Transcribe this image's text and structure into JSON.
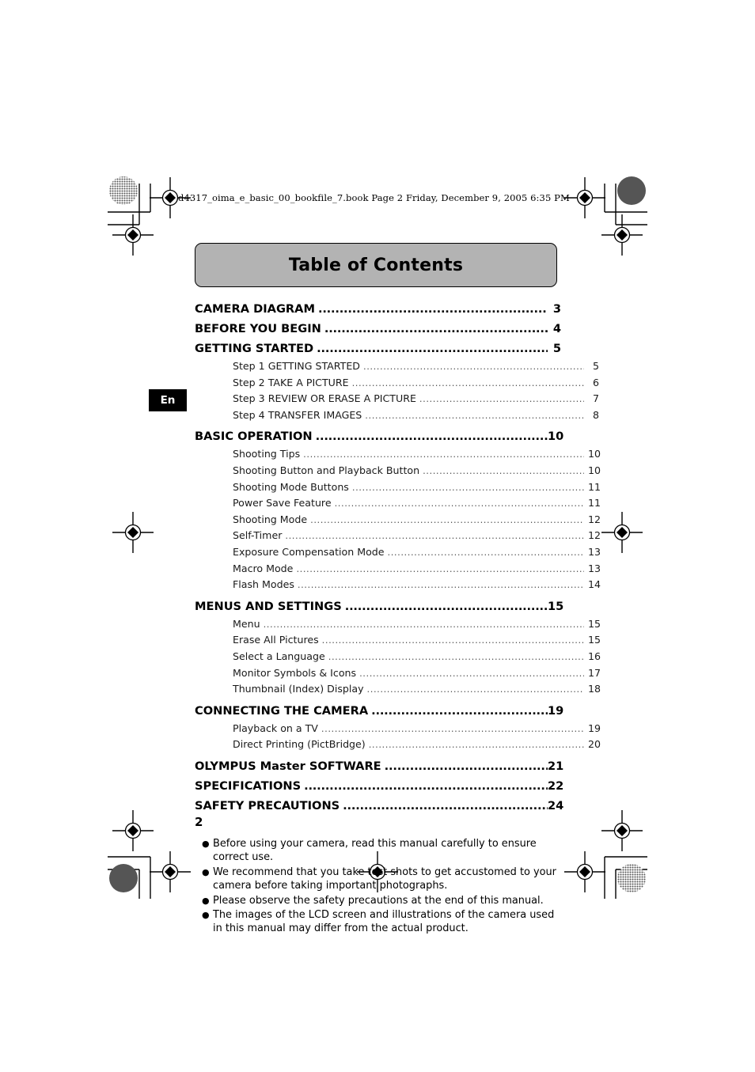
{
  "file_header": "d4317_oima_e_basic_00_bookfile_7.book  Page 2  Friday, December 9, 2005  6:35 PM",
  "language_tab": "En",
  "page_number": "2",
  "title": "Table of Contents",
  "colors": {
    "title_box_fill": "#b3b3b3",
    "title_box_border": "#000000",
    "lang_tab_fill": "#000000",
    "lang_tab_text": "#ffffff"
  },
  "toc": [
    {
      "level": 1,
      "label": "CAMERA DIAGRAM",
      "page": "3"
    },
    {
      "level": 1,
      "label": "BEFORE YOU BEGIN",
      "page": "4"
    },
    {
      "level": 1,
      "label": "GETTING STARTED",
      "page": "5"
    },
    {
      "level": 2,
      "label": "Step 1 GETTING STARTED",
      "page": "5"
    },
    {
      "level": 2,
      "label": "Step 2 TAKE A PICTURE",
      "page": "6"
    },
    {
      "level": 2,
      "label": "Step 3 REVIEW OR ERASE A PICTURE",
      "page": "7"
    },
    {
      "level": 2,
      "label": "Step 4 TRANSFER IMAGES",
      "page": "8"
    },
    {
      "level": 1,
      "label": "BASIC OPERATION",
      "page": "10"
    },
    {
      "level": 2,
      "label": "Shooting Tips",
      "page": "10"
    },
    {
      "level": 2,
      "label": "Shooting Button and Playback Button",
      "page": "10"
    },
    {
      "level": 2,
      "label": "Shooting Mode Buttons",
      "page": "11"
    },
    {
      "level": 2,
      "label": "Power Save Feature",
      "page": "11"
    },
    {
      "level": 2,
      "label": "Shooting Mode",
      "page": "12"
    },
    {
      "level": 2,
      "label": "Self-Timer",
      "page": "12"
    },
    {
      "level": 2,
      "label": "Exposure Compensation Mode",
      "page": "13"
    },
    {
      "level": 2,
      "label": "Macro Mode",
      "page": "13"
    },
    {
      "level": 2,
      "label": "Flash Modes",
      "page": "14"
    },
    {
      "level": 1,
      "label": "MENUS AND SETTINGS",
      "page": "15"
    },
    {
      "level": 2,
      "label": "Menu",
      "page": "15"
    },
    {
      "level": 2,
      "label": "Erase All Pictures",
      "page": "15"
    },
    {
      "level": 2,
      "label": "Select a Language",
      "page": "16"
    },
    {
      "level": 2,
      "label": "Monitor Symbols & Icons",
      "page": "17"
    },
    {
      "level": 2,
      "label": "Thumbnail (Index) Display",
      "page": "18"
    },
    {
      "level": 1,
      "label": "CONNECTING THE CAMERA",
      "page": "19"
    },
    {
      "level": 2,
      "label": "Playback on a TV",
      "page": "19"
    },
    {
      "level": 2,
      "label": "Direct Printing (PictBridge)",
      "page": "20"
    },
    {
      "level": 1,
      "label": "OLYMPUS Master SOFTWARE",
      "page": "21"
    },
    {
      "level": 1,
      "label": "SPECIFICATIONS",
      "page": "22"
    },
    {
      "level": 1,
      "label": "SAFETY PRECAUTIONS",
      "page": "24"
    }
  ],
  "notes": [
    "Before using your camera, read this manual carefully to ensure correct use.",
    "We recommend that you take test shots to get accustomed to your camera before taking important photographs.",
    "Please observe the safety precautions at the end of this manual.",
    "The images of the LCD screen and illustrations of the camera used in this manual may differ from the actual product."
  ]
}
